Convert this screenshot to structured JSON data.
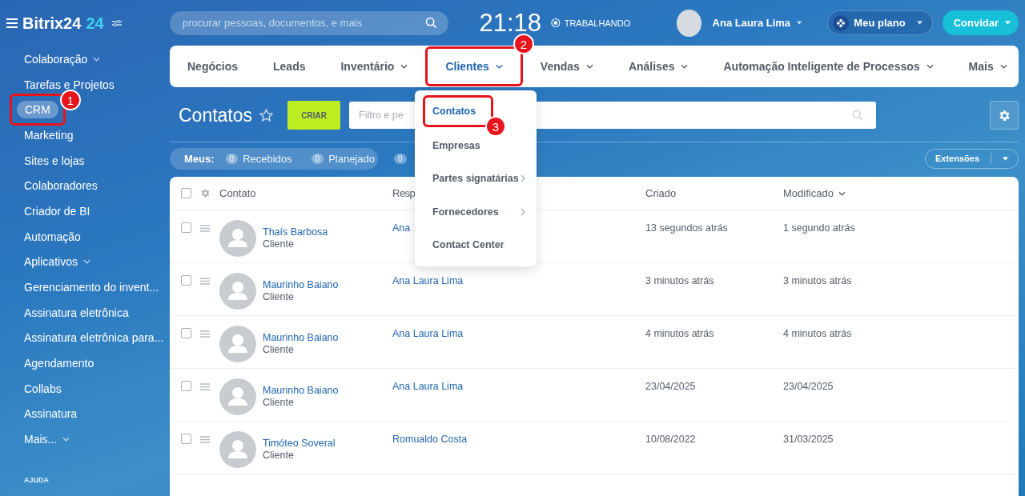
{
  "logo": {
    "name": "Bitrix24",
    "badge": "24"
  },
  "sidebar": {
    "items": [
      {
        "label": "Colaboração",
        "dropdown": true,
        "selected": false
      },
      {
        "label": "Tarefas e Projetos",
        "dropdown": false,
        "selected": false
      },
      {
        "label": "CRM",
        "dropdown": false,
        "selected": true,
        "callout": "1"
      },
      {
        "label": "Marketing",
        "dropdown": false,
        "selected": false
      },
      {
        "label": "Sites e lojas",
        "dropdown": false,
        "selected": false
      },
      {
        "label": "Colaboradores",
        "dropdown": false,
        "selected": false
      },
      {
        "label": "Criador de BI",
        "dropdown": false,
        "selected": false
      },
      {
        "label": "Automação",
        "dropdown": false,
        "selected": false
      },
      {
        "label": "Aplicativos",
        "dropdown": true,
        "selected": false
      },
      {
        "label": "Gerenciamento do invent...",
        "dropdown": false,
        "selected": false
      },
      {
        "label": "Assinatura eletrônica",
        "dropdown": false,
        "selected": false
      },
      {
        "label": "Assinatura eletrônica para...",
        "dropdown": false,
        "selected": false
      },
      {
        "label": "Agendamento",
        "dropdown": false,
        "selected": false
      },
      {
        "label": "Collabs",
        "dropdown": false,
        "selected": false
      },
      {
        "label": "Assinatura",
        "dropdown": false,
        "selected": false
      },
      {
        "label": "Mais...",
        "dropdown": true,
        "selected": false
      }
    ],
    "section": "AJUDA"
  },
  "header": {
    "search_placeholder": "procurar pessoas, documentos, e mais",
    "time": "21:18",
    "status": "TRABALHANDO",
    "user": "Ana Laura Lima",
    "plan": "Meu plano",
    "invite": "Convidar"
  },
  "nav": [
    {
      "label": "Negócios",
      "dropdown": false,
      "selected": false
    },
    {
      "label": "Leads",
      "dropdown": false,
      "selected": false
    },
    {
      "label": "Inventário",
      "dropdown": true,
      "selected": false
    },
    {
      "label": "Clientes",
      "dropdown": true,
      "selected": true,
      "callout": "2"
    },
    {
      "label": "Vendas",
      "dropdown": true,
      "selected": false
    },
    {
      "label": "Análises",
      "dropdown": true,
      "selected": false
    },
    {
      "label": "Automação Inteligente de Processos",
      "dropdown": true,
      "selected": false
    },
    {
      "label": "Mais",
      "dropdown": true,
      "selected": false
    }
  ],
  "menu": [
    {
      "label": "Contatos",
      "selected": true,
      "submenu": false,
      "callout": "3"
    },
    {
      "label": "Empresas",
      "selected": false,
      "submenu": false
    },
    {
      "label": "Partes signatárias",
      "selected": false,
      "submenu": true
    },
    {
      "label": "Fornecedores",
      "selected": false,
      "submenu": true
    },
    {
      "label": "Contact Center",
      "selected": false,
      "submenu": false
    }
  ],
  "page": {
    "title": "Contatos",
    "create": "CRIAR",
    "filter_placeholder": "Filtro e pe",
    "my_label": "Meus:",
    "counters": [
      {
        "count": "0",
        "label": "Recebidos"
      },
      {
        "count": "0",
        "label": "Planejado"
      },
      {
        "count": "0"
      }
    ],
    "extensions": "Extensões"
  },
  "table": {
    "select_all_checked": false,
    "columns": [
      "Contato",
      "Resp",
      "Criado",
      "Modificado"
    ],
    "rows": [
      {
        "checked": false,
        "name": "Thaís Barbosa",
        "type": "Cliente",
        "responsible": "Ana",
        "created": "13 segundos atrás",
        "modified": "1 segundo atrás"
      },
      {
        "name": "Maurinho Baiano",
        "type": "Cliente",
        "responsible": "Ana Laura Lima",
        "checked": false,
        "created": "3 minutos atrás",
        "modified": "3 minutos atrás"
      },
      {
        "name": "Maurinho Baiano",
        "type": "Cliente",
        "responsible": "Ana Laura Lima",
        "checked": false,
        "created": "4 minutos atrás",
        "modified": "4 minutos atrás"
      },
      {
        "name": "Maurinho Baiano",
        "type": "Cliente",
        "responsible": "Ana Laura Lima",
        "checked": false,
        "created": "23/04/2025",
        "modified": "23/04/2025"
      },
      {
        "name": "Timóteo Soveral",
        "type": "Cliente",
        "responsible": "Romualdo Costa",
        "checked": false,
        "created": "10/08/2022",
        "modified": "31/03/2025"
      }
    ]
  }
}
